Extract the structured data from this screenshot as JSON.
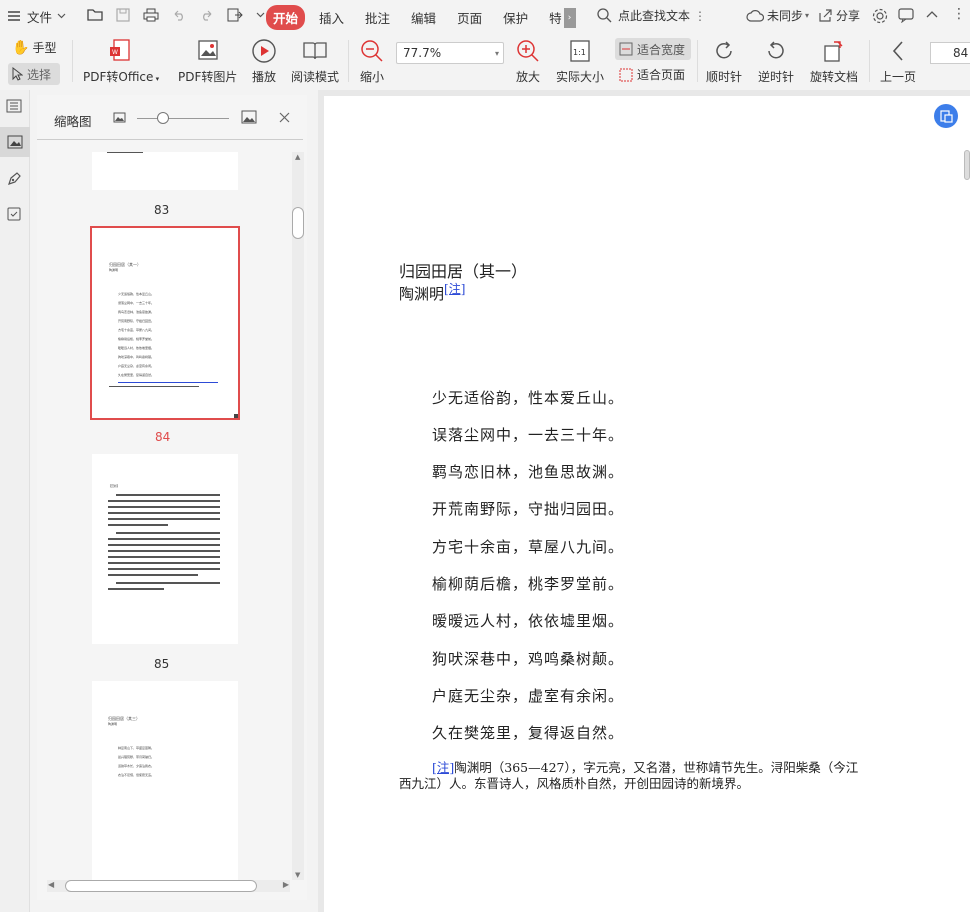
{
  "menubar": {
    "file_label": "文件",
    "tabs": [
      "开始",
      "插入",
      "批注",
      "编辑",
      "页面",
      "保护",
      "特"
    ],
    "active_tab": "开始",
    "search_label": "点此查找文本",
    "sync_label": "未同步",
    "share_label": "分享"
  },
  "ribbon": {
    "hand_label": "手型",
    "select_label": "选择",
    "pdf_to_office": "PDF转Office",
    "pdf_to_image": "PDF转图片",
    "play": "播放",
    "read_mode": "阅读模式",
    "zoom_out": "缩小",
    "zoom_value": "77.7%",
    "zoom_in": "放大",
    "actual_size": "实际大小",
    "fit_width": "适合宽度",
    "fit_page": "适合页面",
    "rotate_cw": "顺时针",
    "rotate_ccw": "逆时针",
    "rotate_doc": "旋转文档",
    "prev_page": "上一页",
    "page_number": "84"
  },
  "thumbnails": {
    "title": "缩略图",
    "pages": [
      {
        "num": "83"
      },
      {
        "num": "84",
        "selected": true
      },
      {
        "num": "85"
      }
    ],
    "thumb84": {
      "title": "归园田居（其一）",
      "author": "陶渊明",
      "lines": [
        "少无适俗韵，性本爱丘山。",
        "误落尘网中，一去三十年。",
        "羁鸟恋旧林，池鱼思故渊。",
        "开荒南野际，守拙归园田。",
        "方宅十余亩，草屋八九间。",
        "榆柳荫后檐，桃李罗堂前。",
        "暧暧远人村，依依墟里烟。",
        "狗吠深巷中，鸡鸣桑树颠。",
        "户庭无尘杂，虚室有余闲。",
        "久在樊笼里，复得返自然。"
      ]
    },
    "thumb86": {
      "title": "归园田居（其三）",
      "author": "陶渊明",
      "lines": [
        "种豆南山下，草盛豆苗稀。",
        "晨兴理荒秽，带月荷锄归。",
        "道狭草木长，夕露沾我衣。",
        "衣沾不足惜，但使愿无违。"
      ]
    },
    "thumb85_heading": "【赏析】"
  },
  "document": {
    "title": "归园田居（其一）",
    "author": "陶渊明",
    "note_marker": "[注]",
    "lines": [
      "少无适俗韵，性本爱丘山。",
      "误落尘网中，一去三十年。",
      "羁鸟恋旧林，池鱼思故渊。",
      "开荒南野际，守拙归园田。",
      "方宅十余亩，草屋八九间。",
      "榆柳荫后檐，桃李罗堂前。",
      "暧暧远人村，依依墟里烟。",
      "狗吠深巷中，鸡鸣桑树颠。",
      "户庭无尘杂，虚室有余闲。",
      "久在樊笼里，复得返自然。"
    ],
    "footnote_marker": "[注]",
    "footnote_line1": "陶渊明（365—427），字元亮，又名潜，世称靖节先生。浔阳柴桑（今江",
    "footnote_line2": "西九江）人。东晋诗人，风格质朴自然，开创田园诗的新境界。"
  },
  "colors": {
    "accent": "#e04c4c",
    "link": "#2d4bd6",
    "float_btn": "#3d7eea"
  }
}
